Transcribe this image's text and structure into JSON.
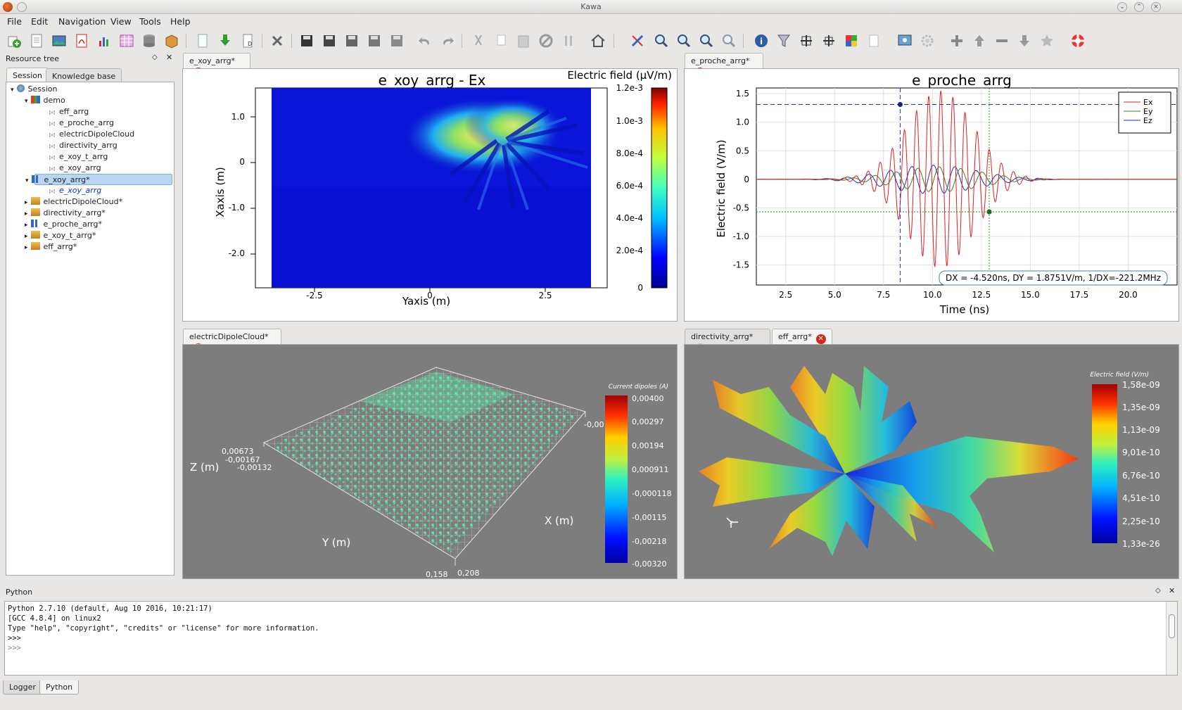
{
  "window": {
    "title": "Kawa"
  },
  "menu": [
    "File",
    "Edit",
    "Navigation",
    "View",
    "Tools",
    "Help"
  ],
  "left_panel": {
    "title": "Resource tree",
    "tabs": [
      "Session",
      "Knowledge base"
    ]
  },
  "tree": {
    "root": "Session",
    "demo": "demo",
    "demo_children": [
      "eff_arrg",
      "e_proche_arrg",
      "electricDipoleCloud",
      "directivity_arrg",
      "e_xoy_t_arrg",
      "e_xoy_arrg"
    ],
    "selected": "e_xoy_arrg*",
    "selected_child": "e_xoy_arrg",
    "others": [
      "electricDipoleCloud*",
      "directivity_arrg*",
      "e_proche_arrg*",
      "e_xoy_t_arrg*",
      "eff_arrg*"
    ]
  },
  "views": {
    "tl": {
      "tab": "e_xoy_arrg*"
    },
    "tr": {
      "tab": "e_proche_arrg*"
    },
    "bl": {
      "tab": "electricDipoleCloud*"
    },
    "br": {
      "tabs": [
        "directivity_arrg*",
        "eff_arrg*"
      ]
    }
  },
  "heatmap": {
    "title": "e_xoy_arrg - Ex",
    "xlabel": "Yaxis (m)",
    "ylabel": "Xaxis (m)",
    "xticks": [
      "-2.5",
      "0",
      "2.5"
    ],
    "yticks": [
      "1.0",
      "0",
      "-1.0",
      "-2.0"
    ],
    "colorbar_title": "Electric field (µV/m)",
    "colorbar_ticks": [
      "1.2e-3",
      "1.0e-3",
      "8.0e-4",
      "6.0e-4",
      "4.0e-4",
      "2.0e-4",
      "0"
    ]
  },
  "chart_data": {
    "type": "line",
    "title": "e_proche_arrg",
    "xlabel": "Time (ns)",
    "ylabel": "Electric field (V/m)",
    "xlim": [
      1,
      22.5
    ],
    "ylim": [
      -1.85,
      1.6
    ],
    "xticks": [
      "2.5",
      "5.0",
      "7.5",
      "10.0",
      "12.5",
      "15.0",
      "17.5",
      "20.0"
    ],
    "yticks": [
      "1.5",
      "1.0",
      "0.5",
      "0",
      "-0.5",
      "-1.0",
      "-1.5"
    ],
    "legend_position": "top-right",
    "series": [
      {
        "name": "Ex",
        "color": "#e02020",
        "envelope_peak": 1.55,
        "center": 10.4,
        "period": 0.62,
        "decay": 2.4
      },
      {
        "name": "Ey",
        "color": "#2a8a2a",
        "envelope_peak": 0.22,
        "center": 10.3,
        "period": 1.1,
        "decay": 3.0
      },
      {
        "name": "Ez",
        "color": "#1c2fc4",
        "envelope_peak": 0.25,
        "center": 10.0,
        "period": 1.1,
        "decay": 3.2
      }
    ],
    "markers": [
      {
        "x": 8.35,
        "y": 1.31
      },
      {
        "x": 12.9,
        "y": -0.57
      }
    ],
    "readout": "DX = -4.520ns, DY = 1.8751V/m, 1/DX=-221.2MHz"
  },
  "dipole_cloud": {
    "axis_labels": {
      "z": "Z (m)",
      "y": "Y (m)",
      "x": "X (m)"
    },
    "tick_labels": [
      "0,00673",
      "-0,00167",
      "-0,00132",
      "0,158",
      "0,208",
      "-0,00"
    ],
    "colorbar_title": "Current dipoles (A)",
    "colorbar_ticks": [
      "0,00400",
      "0,00297",
      "0,00194",
      "0,000911",
      "-0,000118",
      "-0,00115",
      "-0,00218",
      "-0,00320"
    ]
  },
  "radiation": {
    "colorbar_title": "Electric field (V/m)",
    "colorbar_ticks": [
      "1,58e-09",
      "1,35e-09",
      "1,13e-09",
      "9,01e-10",
      "6,76e-10",
      "4,51e-10",
      "2,25e-10",
      "1,33e-26"
    ]
  },
  "console": {
    "title": "Python",
    "lines": [
      "Python 2.7.10 (default, Aug 10 2016, 10:21:17)",
      "[GCC 4.8.4] on linux2",
      "Type \"help\", \"copyright\", \"credits\" or \"license\" for more information.",
      ">>>",
      ">>>"
    ]
  },
  "bottom_tabs": [
    "Logger",
    "Python"
  ],
  "colors": {
    "accent": "#3d7bd9",
    "close_red": "#d5281c",
    "selection": "#b9d7f3"
  }
}
